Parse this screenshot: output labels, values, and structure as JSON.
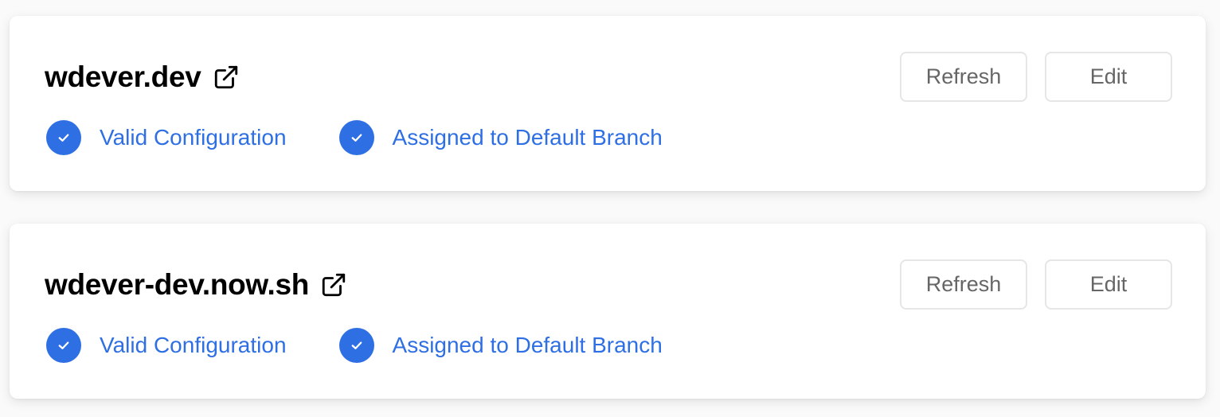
{
  "colors": {
    "accent": "#2f6fe4",
    "card_bg": "#ffffff",
    "page_bg": "#fafafa",
    "button_border": "#e6e6e6",
    "button_text": "#666666"
  },
  "domains": [
    {
      "name": "wdever.dev",
      "link_icon": "external-link-icon",
      "statuses": [
        {
          "icon": "check-circle-icon",
          "label": "Valid Configuration"
        },
        {
          "icon": "check-circle-icon",
          "label": "Assigned to Default Branch"
        }
      ],
      "actions": {
        "refresh_label": "Refresh",
        "edit_label": "Edit"
      }
    },
    {
      "name": "wdever-dev.now.sh",
      "link_icon": "external-link-icon",
      "statuses": [
        {
          "icon": "check-circle-icon",
          "label": "Valid Configuration"
        },
        {
          "icon": "check-circle-icon",
          "label": "Assigned to Default Branch"
        }
      ],
      "actions": {
        "refresh_label": "Refresh",
        "edit_label": "Edit"
      }
    }
  ]
}
